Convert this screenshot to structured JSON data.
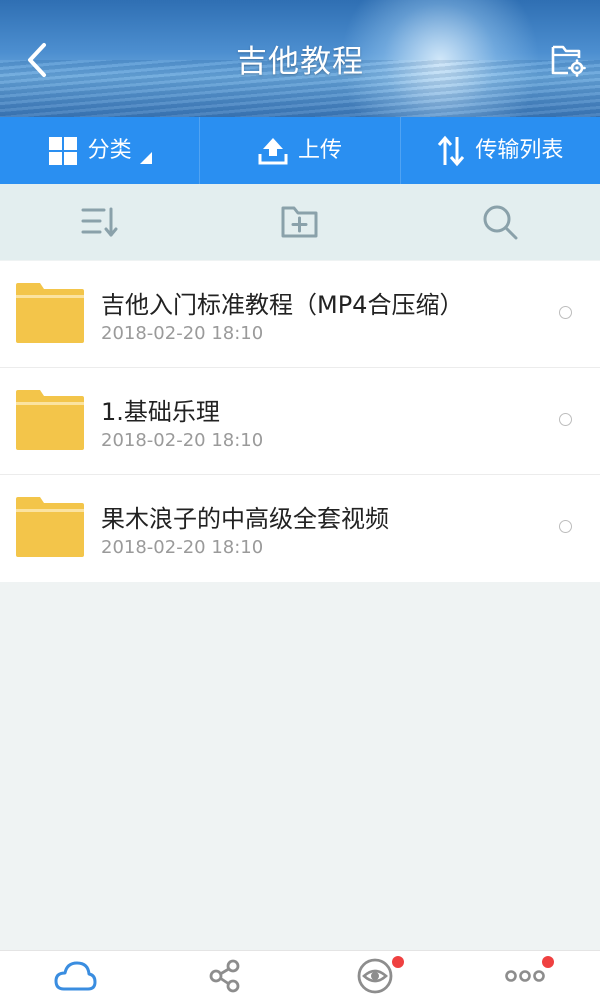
{
  "header": {
    "title": "吉他教程",
    "back_icon": "chevron-left-icon",
    "settings_icon": "folder-settings-icon"
  },
  "actions": [
    {
      "label": "分类",
      "icon": "grid-icon",
      "has_dropdown": true
    },
    {
      "label": "上传",
      "icon": "upload-icon"
    },
    {
      "label": "传输列表",
      "icon": "transfer-arrows-icon"
    }
  ],
  "toolbar": {
    "sort_icon": "sort-icon",
    "new_folder_icon": "new-folder-icon",
    "search_icon": "search-icon"
  },
  "files": [
    {
      "name": "吉他入门标准教程（MP4合压缩）",
      "time": "2018-02-20  18:10"
    },
    {
      "name": "1.基础乐理",
      "time": "2018-02-20  18:10"
    },
    {
      "name": "果木浪子的中高级全套视频",
      "time": "2018-02-20  18:10"
    }
  ],
  "bottom_nav": [
    {
      "icon": "cloud-icon",
      "badge": false,
      "active": true
    },
    {
      "icon": "share-icon",
      "badge": false
    },
    {
      "icon": "eye-icon",
      "badge": true
    },
    {
      "icon": "more-icon",
      "badge": true
    }
  ],
  "colors": {
    "accent": "#2a8ff1",
    "toolbar_bg": "#e3eeef",
    "folder": "#f3c54a",
    "badge": "#ef4040",
    "icon_gray": "#8aa1aa",
    "nav_active": "#3a8de0"
  }
}
